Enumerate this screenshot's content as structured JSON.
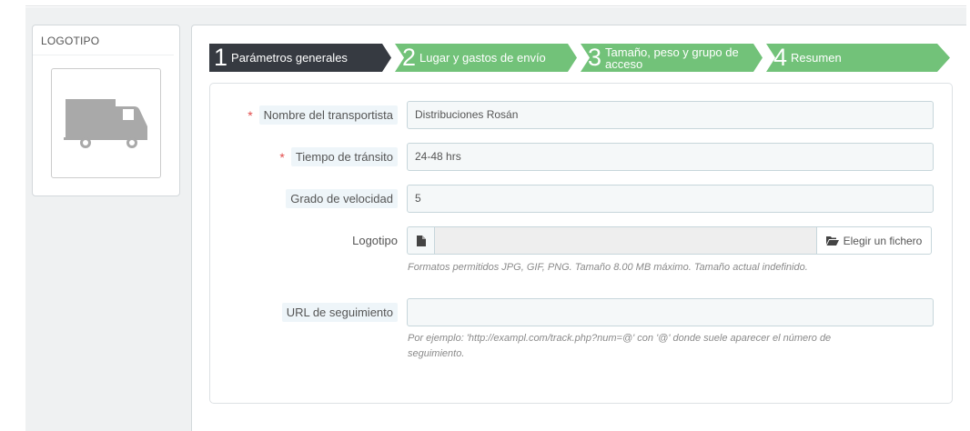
{
  "logo_panel": {
    "heading": "LOGOTIPO",
    "image_icon": "truck-icon"
  },
  "wizard": {
    "steps": [
      {
        "number": "1",
        "label": "Parámetros generales",
        "active": true
      },
      {
        "number": "2",
        "label": "Lugar y gastos de envío",
        "active": false
      },
      {
        "number": "3",
        "label": "Tamaño, peso y grupo de acceso",
        "active": false
      },
      {
        "number": "4",
        "label": "Resumen",
        "active": false
      }
    ]
  },
  "form": {
    "carrier_name": {
      "label": "Nombre del transportista",
      "required": true,
      "value": "Distribuciones Rosán"
    },
    "transit_time": {
      "label": "Tiempo de tránsito",
      "required": true,
      "value": "24-48 hrs"
    },
    "speed_grade": {
      "label": "Grado de velocidad",
      "value": "5"
    },
    "logo": {
      "label": "Logotipo",
      "button_label": "Elegir un fichero",
      "help": "Formatos permitidos JPG, GIF, PNG. Tamaño 8.00 MB máximo. Tamaño actual indefinido."
    },
    "tracking_url": {
      "label": "URL de seguimiento",
      "value": "",
      "help_line1": "Por ejemplo: 'http://exampl.com/track.php?num=@' con '@' donde suele aparecer el número de",
      "help_line2": "seguimiento."
    }
  },
  "colors": {
    "active_step": "#363a41",
    "inactive_step": "#72c279",
    "required": "#e24c4b"
  }
}
